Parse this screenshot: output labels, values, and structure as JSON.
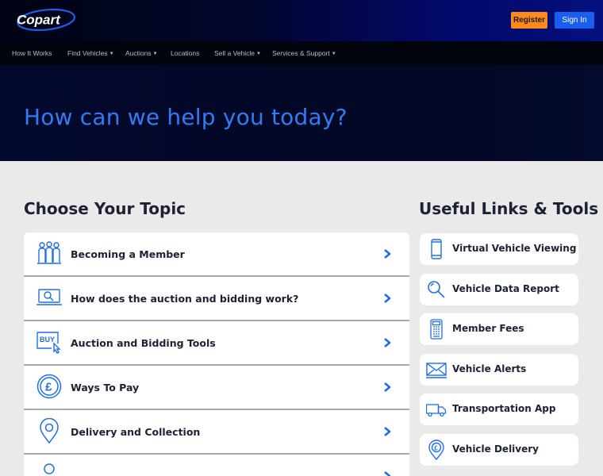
{
  "brand": {
    "logo_text": "Copart",
    "accent": "#1a5ef0",
    "orange": "#ff8a1c"
  },
  "header": {
    "register_label": "Register",
    "signin_label": "Sign In"
  },
  "nav": {
    "items": [
      {
        "label": "How It Works",
        "dropdown": false
      },
      {
        "label": "Find Vehicles",
        "dropdown": true
      },
      {
        "label": "Auctions",
        "dropdown": true
      },
      {
        "label": "Locations",
        "dropdown": false
      },
      {
        "label": "Sell a Vehicle",
        "dropdown": true
      },
      {
        "label": "Services & Support",
        "dropdown": true
      }
    ]
  },
  "hero": {
    "title": "How can we help you today?"
  },
  "topics": {
    "title": "Choose Your Topic",
    "items": [
      {
        "label": "Becoming a Member",
        "icon": "members-icon"
      },
      {
        "label": "How does the auction and bidding work?",
        "icon": "laptop-search-icon"
      },
      {
        "label": "Auction and Bidding Tools",
        "icon": "buy-cursor-icon"
      },
      {
        "label": "Ways To Pay",
        "icon": "pound-coin-icon"
      },
      {
        "label": "Delivery and Collection",
        "icon": "location-pin-icon"
      },
      {
        "label": "",
        "icon": "person-icon"
      }
    ]
  },
  "tools": {
    "title": "Useful Links & Tools",
    "items": [
      {
        "label": "Virtual Vehicle Viewing",
        "icon": "phone-icon"
      },
      {
        "label": "Vehicle Data Report",
        "icon": "magnifier-icon"
      },
      {
        "label": "Member Fees",
        "icon": "calculator-icon"
      },
      {
        "label": "Vehicle Alerts",
        "icon": "envelope-icon"
      },
      {
        "label": "Transportation App",
        "icon": "truck-icon"
      },
      {
        "label": "Vehicle Delivery",
        "icon": "pound-pin-icon"
      }
    ]
  }
}
